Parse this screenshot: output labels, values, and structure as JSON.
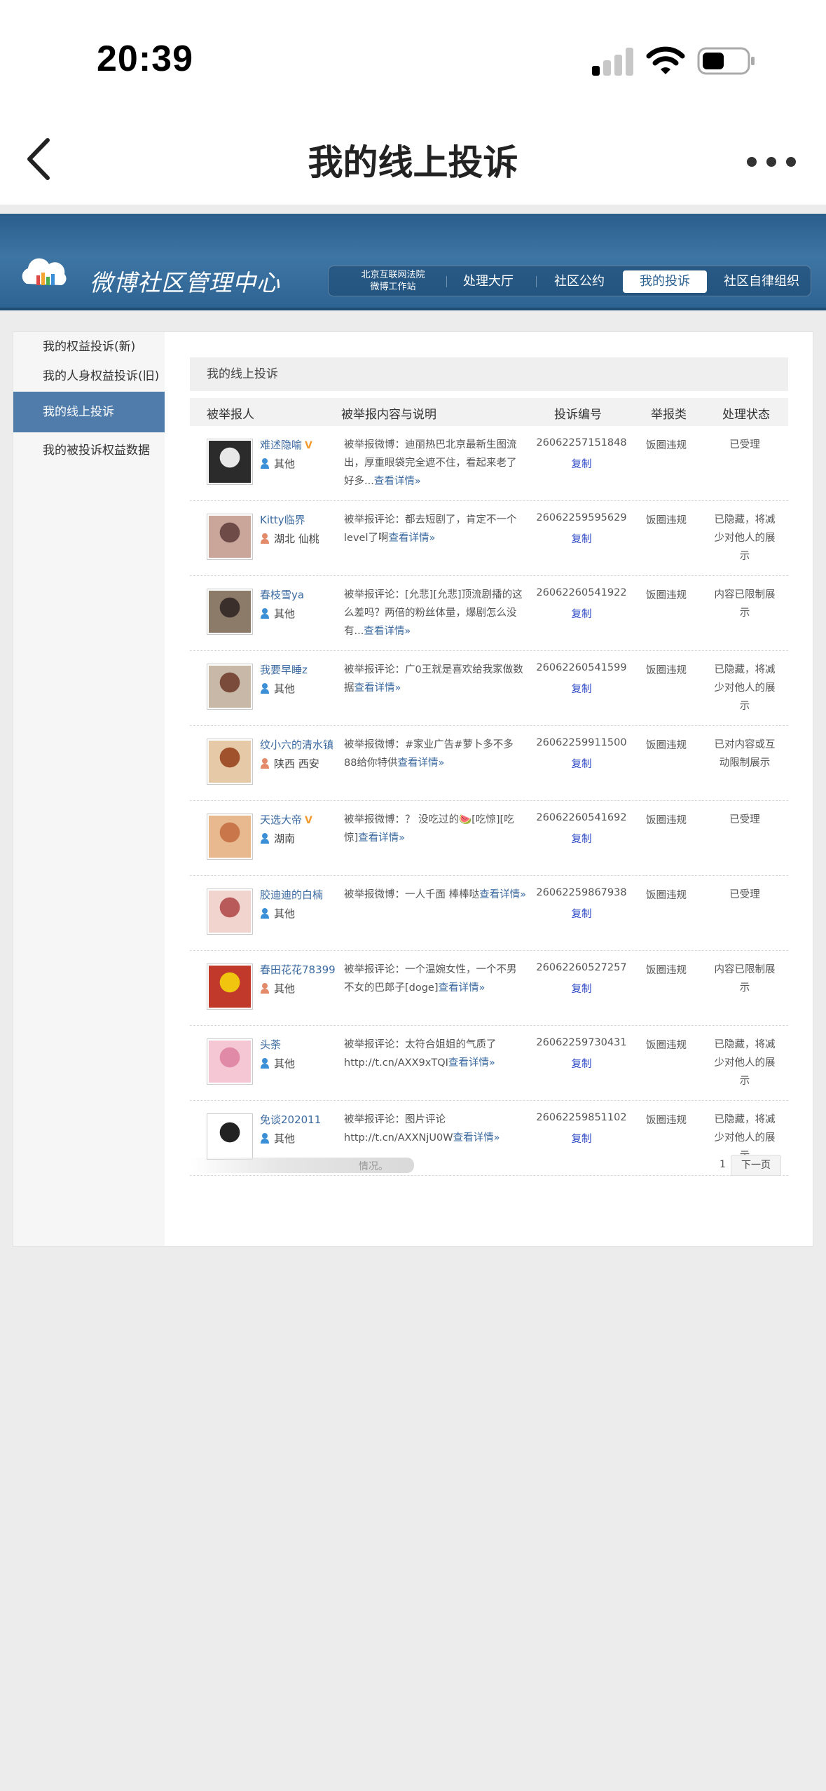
{
  "status_bar": {
    "time": "20:39"
  },
  "nav": {
    "title": "我的线上投诉"
  },
  "weibo": {
    "logo": "微博社区管理中心",
    "court_line1": "北京互联网法院",
    "court_line2": "微博工作站",
    "tabs": [
      "处理大厅",
      "社区公约",
      "我的投诉",
      "社区自律组织"
    ],
    "active_tab": "我的投诉"
  },
  "sidebar": {
    "items": [
      "我的权益投诉(新)",
      "我的人身权益投诉(旧)",
      "我的线上投诉",
      "我的被投诉权益数据"
    ],
    "active": "我的线上投诉"
  },
  "main": {
    "title": "我的线上投诉",
    "columns": [
      "被举报人",
      "被举报内容与说明",
      "投诉编号",
      "举报类",
      "处理状态"
    ],
    "rows": [
      {
        "name": "难述隐喻",
        "vip": true,
        "loc": "其他",
        "desc": "被举报微博：迪丽热巴北京最新生图流出，厚重眼袋完全遮不住，看起来老了好多...",
        "more": "查看详情»",
        "id": "26062257151848",
        "copy": "复制",
        "type": "饭圈违规",
        "status": "已受理"
      },
      {
        "name": "Kitty临界",
        "vip": false,
        "loc": "湖北 仙桃",
        "desc": "被举报评论：都去短剧了，肯定不一个level了啊",
        "more": "查看详情»",
        "id": "26062259595629",
        "copy": "复制",
        "type": "饭圈违规",
        "status": "已隐藏，将减少对他人的展示"
      },
      {
        "name": "春枝雪ya",
        "vip": false,
        "loc": "其他",
        "desc": "被举报评论：[允悲][允悲]顶流剧播的这么差吗？两倍的粉丝体量，爆剧怎么没有...",
        "more": "查看详情»",
        "id": "26062260541922",
        "copy": "复制",
        "type": "饭圈违规",
        "status": "内容已限制展示"
      },
      {
        "name": "我要早睡z",
        "vip": false,
        "loc": "其他",
        "desc": "被举报评论：广0王就是喜欢给我家做数据",
        "more": "查看详情»",
        "id": "26062260541599",
        "copy": "复制",
        "type": "饭圈违规",
        "status": "已隐藏，将减少对他人的展示"
      },
      {
        "name": "纹小六的清水镇",
        "vip": false,
        "loc": "陕西 西安",
        "desc": "被举报微博：#家业广告#萝卜多不多 88给你特供",
        "more": "查看详情»",
        "id": "26062259911500",
        "copy": "复制",
        "type": "饭圈违规",
        "status": "已对内容或互动限制展示"
      },
      {
        "name": "天选大帝",
        "vip": true,
        "loc": "湖南",
        "desc": "被举报微博：？ 没吃过的🍉[吃惊][吃惊]",
        "more": "查看详情»",
        "id": "26062260541692",
        "copy": "复制",
        "type": "饭圈违规",
        "status": "已受理"
      },
      {
        "name": "胶迪迪的白楠",
        "vip": false,
        "loc": "其他",
        "desc": "被举报微博：一人千面 棒棒哒",
        "more": "查看详情»",
        "id": "26062259867938",
        "copy": "复制",
        "type": "饭圈违规",
        "status": "已受理"
      },
      {
        "name": "春田花花78399",
        "vip": false,
        "loc": "其他",
        "desc": "被举报评论：一个温婉女性，一个不男不女的巴郎子[doge]",
        "more": "查看详情»",
        "id": "26062260527257",
        "copy": "复制",
        "type": "饭圈违规",
        "status": "内容已限制展示"
      },
      {
        "name": "头荼",
        "vip": false,
        "loc": "其他",
        "desc": "被举报评论：太符合姐姐的气质了 http://t.cn/AXX9xTQI",
        "more": "查看详情»",
        "id": "26062259730431",
        "copy": "复制",
        "type": "饭圈违规",
        "status": "已隐藏，将减少对他人的展示"
      },
      {
        "name": "免谈202011",
        "vip": false,
        "loc": "其他",
        "desc": "被举报评论：图片评论 http://t.cn/AXXNjU0W",
        "more": "查看详情»",
        "id": "26062259851102",
        "copy": "复制",
        "type": "饭圈违规",
        "status": "已隐藏，将减少对他人的展示"
      }
    ]
  },
  "pager": {
    "note": "情况。",
    "page": "1",
    "next": "下一页"
  }
}
